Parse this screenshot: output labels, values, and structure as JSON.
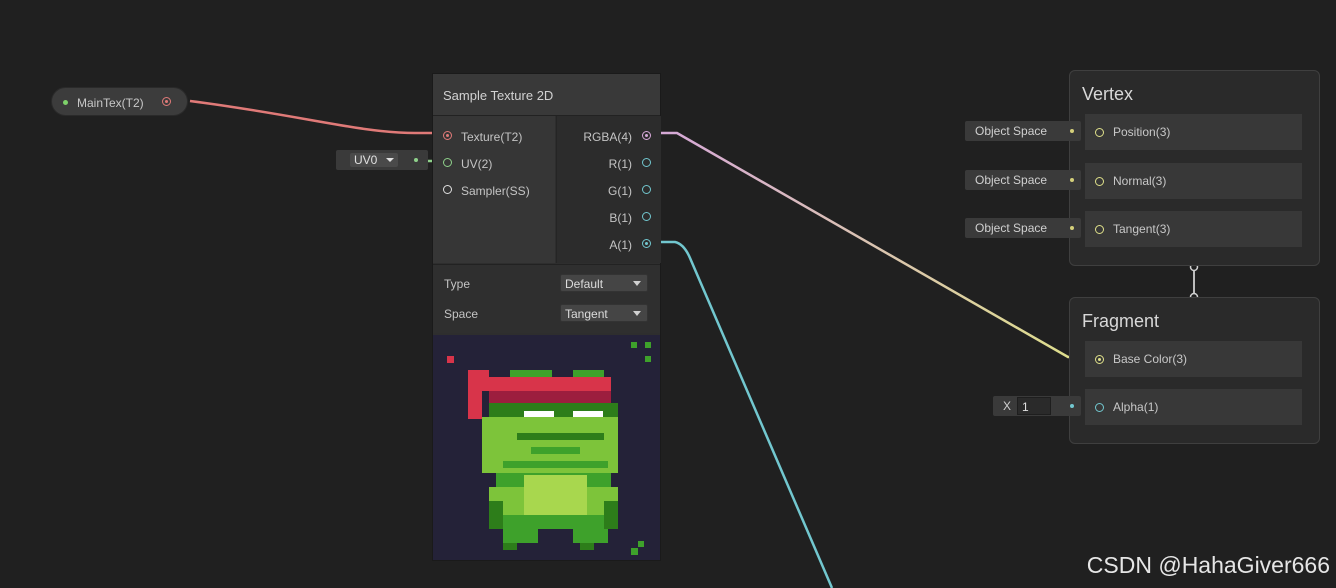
{
  "property_node": {
    "label": "MainTex(T2)"
  },
  "sample_texture": {
    "title": "Sample Texture 2D",
    "inputs": [
      "Texture(T2)",
      "UV(2)",
      "Sampler(SS)"
    ],
    "outputs": [
      "RGBA(4)",
      "R(1)",
      "G(1)",
      "B(1)",
      "A(1)"
    ],
    "type_label": "Type",
    "type_value": "Default",
    "space_label": "Space",
    "space_value": "Tangent"
  },
  "uv_selector": {
    "value": "UV0"
  },
  "vertex": {
    "title": "Vertex",
    "slots": [
      "Position(3)",
      "Normal(3)",
      "Tangent(3)"
    ],
    "space_pills": [
      "Object Space",
      "Object Space",
      "Object Space"
    ]
  },
  "fragment": {
    "title": "Fragment",
    "slots": [
      "Base Color(3)",
      "Alpha(1)"
    ],
    "alpha_field_label": "X",
    "alpha_value": "1"
  },
  "watermark": "CSDN @HahaGiver666",
  "colors": {
    "texture_wire": "#e07a78",
    "uv_wire": "#8ed08a",
    "vector4_wire": "#d6a8d8",
    "vector3_wire": "#dfe08a",
    "float_wire": "#72c7cf"
  }
}
